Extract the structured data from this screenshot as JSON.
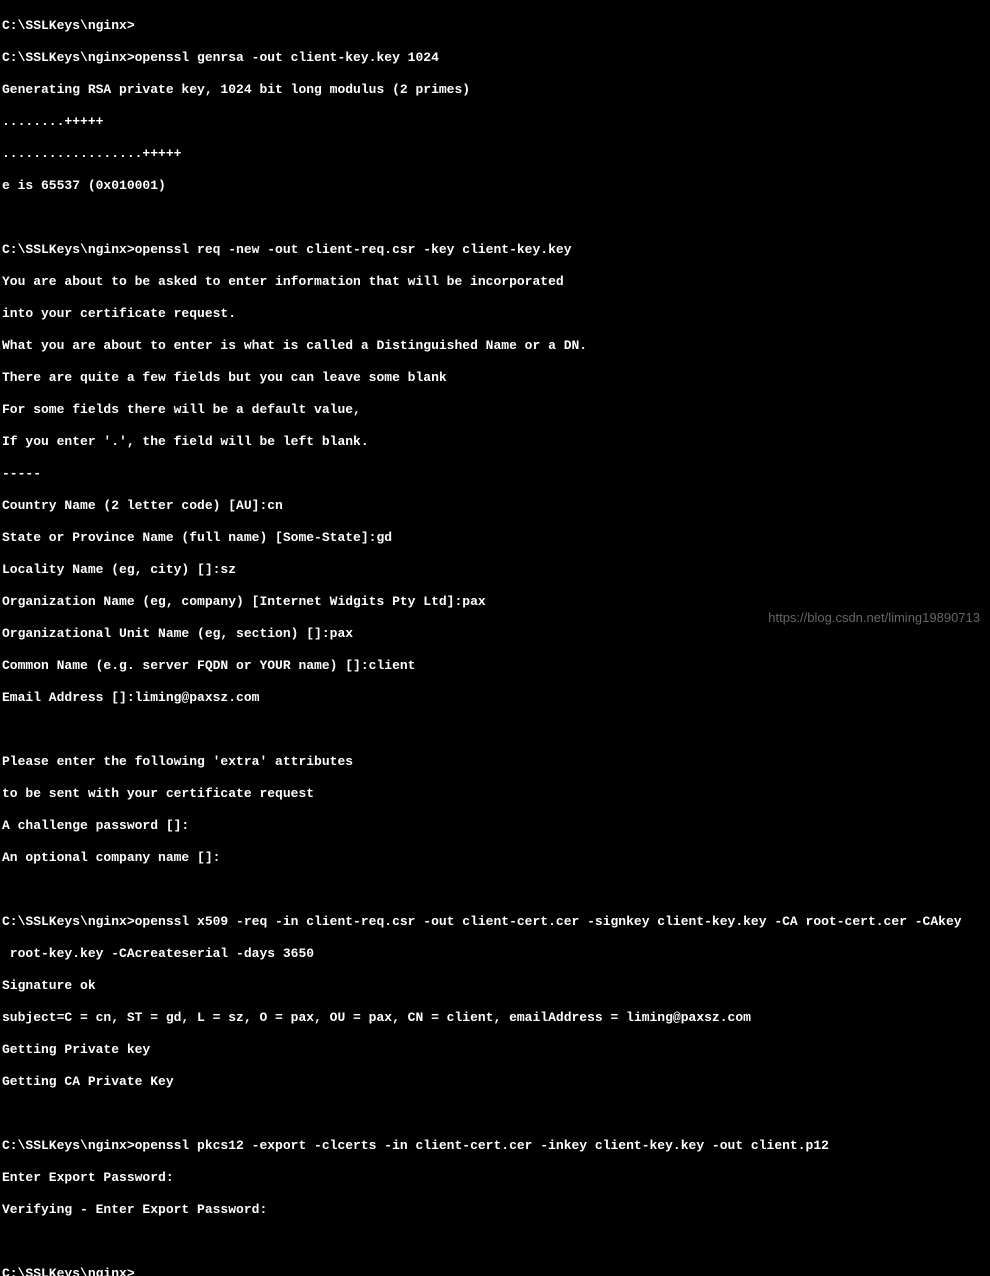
{
  "prompt": "C:\\SSLKeys\\nginx>",
  "lines": [
    "C:\\SSLKeys\\nginx>",
    "C:\\SSLKeys\\nginx>openssl genrsa -out client-key.key 1024",
    "Generating RSA private key, 1024 bit long modulus (2 primes)",
    "........+++++",
    "..................+++++",
    "e is 65537 (0x010001)",
    "",
    "C:\\SSLKeys\\nginx>openssl req -new -out client-req.csr -key client-key.key",
    "You are about to be asked to enter information that will be incorporated",
    "into your certificate request.",
    "What you are about to enter is what is called a Distinguished Name or a DN.",
    "There are quite a few fields but you can leave some blank",
    "For some fields there will be a default value,",
    "If you enter '.', the field will be left blank.",
    "-----",
    "Country Name (2 letter code) [AU]:cn",
    "State or Province Name (full name) [Some-State]:gd",
    "Locality Name (eg, city) []:sz",
    "Organization Name (eg, company) [Internet Widgits Pty Ltd]:pax",
    "Organizational Unit Name (eg, section) []:pax",
    "Common Name (e.g. server FQDN or YOUR name) []:client",
    "Email Address []:liming@paxsz.com",
    "",
    "Please enter the following 'extra' attributes",
    "to be sent with your certificate request",
    "A challenge password []:",
    "An optional company name []:",
    "",
    "C:\\SSLKeys\\nginx>openssl x509 -req -in client-req.csr -out client-cert.cer -signkey client-key.key -CA root-cert.cer -CAkey",
    " root-key.key -CAcreateserial -days 3650",
    "Signature ok",
    "subject=C = cn, ST = gd, L = sz, O = pax, OU = pax, CN = client, emailAddress = liming@paxsz.com",
    "Getting Private key",
    "Getting CA Private Key",
    "",
    "C:\\SSLKeys\\nginx>openssl pkcs12 -export -clcerts -in client-cert.cer -inkey client-key.key -out client.p12",
    "Enter Export Password:",
    "Verifying - Enter Export Password:",
    "",
    "C:\\SSLKeys\\nginx>"
  ],
  "watermark": "https://blog.csdn.net/liming19890713"
}
